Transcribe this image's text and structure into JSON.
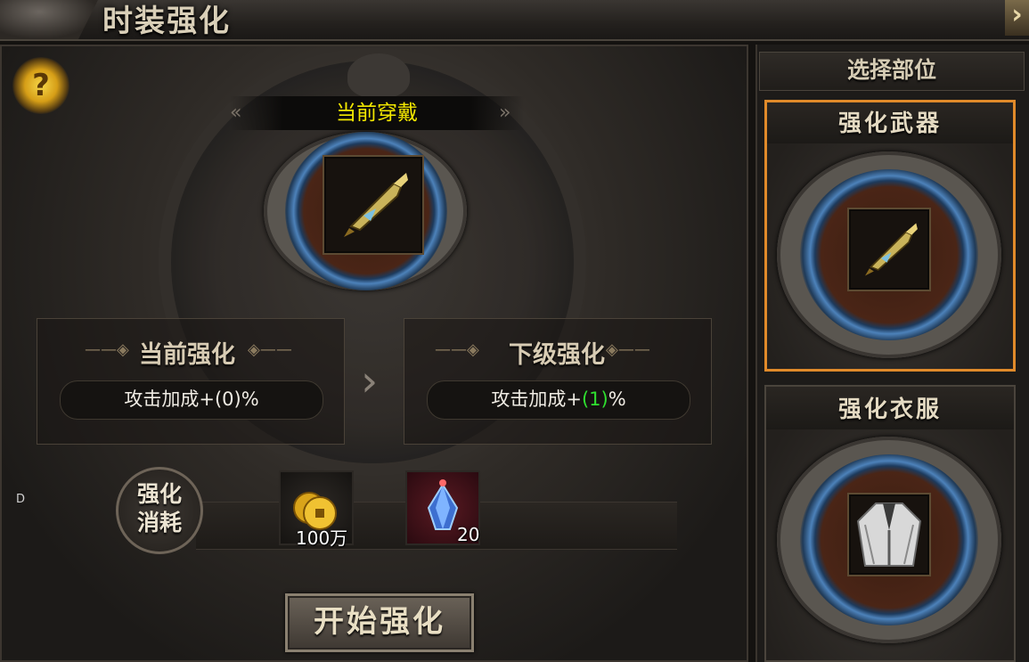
{
  "window": {
    "title": "时装强化",
    "close_label": "›"
  },
  "help": {
    "label": "?"
  },
  "current_wear": {
    "label": "当前穿戴",
    "item": "weapon-sword-icon"
  },
  "enhance": {
    "current": {
      "title": "当前强化",
      "stat_prefix": "攻击加成+",
      "value": "(0)",
      "suffix": "%"
    },
    "next": {
      "title": "下级强化",
      "stat_prefix": "攻击加成+",
      "value": "(1)",
      "suffix": "%",
      "value_color": "#2fe02f"
    }
  },
  "cost": {
    "label_line1": "强化",
    "label_line2": "消耗",
    "items": [
      {
        "icon": "gold-coins-icon",
        "count": "100万"
      },
      {
        "icon": "crystal-gem-icon",
        "count": "20"
      }
    ]
  },
  "side_marker": "D",
  "start_button": "开始强化",
  "side_panel": {
    "header": "选择部位",
    "parts": [
      {
        "label": "强化武器",
        "icon": "weapon-sword-icon",
        "selected": true
      },
      {
        "label": "强化衣服",
        "icon": "robe-icon",
        "selected": false
      }
    ]
  },
  "colors": {
    "highlight_border": "#e08a2a",
    "wear_text": "#f3e800",
    "next_value": "#2fe02f"
  }
}
